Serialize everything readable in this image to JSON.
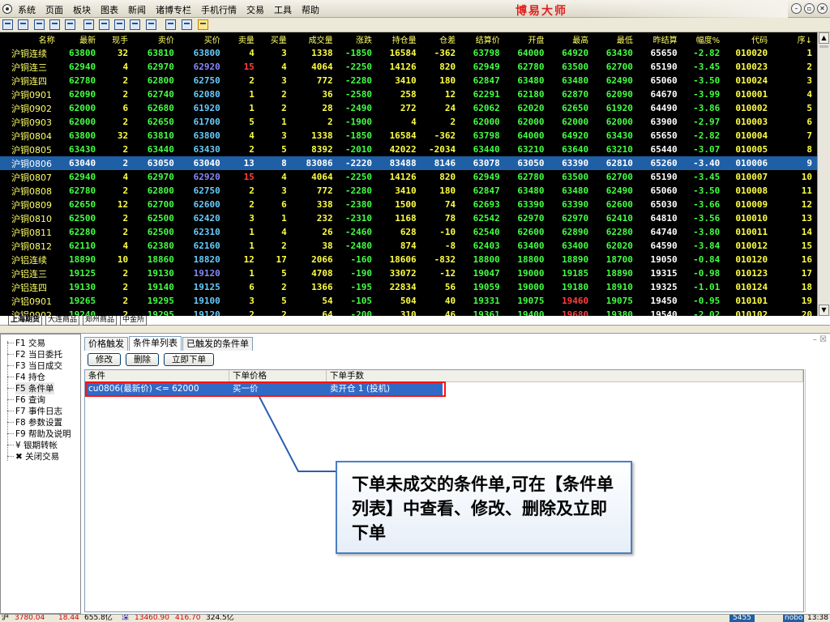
{
  "app": {
    "title": "博易大师"
  },
  "menu": [
    "系统",
    "页面",
    "板块",
    "图表",
    "新闻",
    "诸博专栏",
    "手机行情",
    "交易",
    "工具",
    "帮助"
  ],
  "toolbar_icons": [
    "window-icon",
    "line-chart-icon",
    "grid-icon",
    "table-icon",
    "report-icon",
    "refresh-icon",
    "pin-icon",
    "pin2-icon",
    "timer-icon",
    "export-icon",
    "alert-icon",
    "group-icon",
    "flash-icon"
  ],
  "quotes": {
    "columns": [
      "名称",
      "最新",
      "现手",
      "卖价",
      "买价",
      "卖量",
      "买量",
      "成交量",
      "涨跌",
      "持仓量",
      "仓差",
      "结算价",
      "开盘",
      "最高",
      "最低",
      "昨结算",
      "幅度%",
      "代码",
      "序↓"
    ],
    "rows": [
      {
        "name": "沪铜连续",
        "last": "63800",
        "vol": "32",
        "ask": "63810",
        "bid": "63800",
        "askv": "4",
        "bidv": "3",
        "volume": "1338",
        "chg": "-1850",
        "oi": "16584",
        "oid": "-362",
        "settle": "63798",
        "open": "64000",
        "high": "64920",
        "low": "63430",
        "prev": "65650",
        "pct": "-2.82",
        "code": "010020",
        "seq": "1"
      },
      {
        "name": "沪铜连三",
        "last": "62940",
        "vol": "4",
        "ask": "62970",
        "bid": "62920",
        "askv": "15",
        "bidv": "4",
        "volume": "4064",
        "chg": "-2250",
        "oi": "14126",
        "oid": "820",
        "settle": "62949",
        "open": "62780",
        "high": "63500",
        "low": "62700",
        "prev": "65190",
        "pct": "-3.45",
        "code": "010023",
        "seq": "2"
      },
      {
        "name": "沪铜连四",
        "last": "62780",
        "vol": "2",
        "ask": "62800",
        "bid": "62750",
        "askv": "2",
        "bidv": "3",
        "volume": "772",
        "chg": "-2280",
        "oi": "3410",
        "oid": "180",
        "settle": "62847",
        "open": "63480",
        "high": "63480",
        "low": "62490",
        "prev": "65060",
        "pct": "-3.50",
        "code": "010024",
        "seq": "3"
      },
      {
        "name": "沪铜0901",
        "last": "62090",
        "vol": "2",
        "ask": "62740",
        "bid": "62080",
        "askv": "1",
        "bidv": "2",
        "volume": "36",
        "chg": "-2580",
        "oi": "258",
        "oid": "12",
        "settle": "62291",
        "open": "62180",
        "high": "62870",
        "low": "62090",
        "prev": "64670",
        "pct": "-3.99",
        "code": "010001",
        "seq": "4"
      },
      {
        "name": "沪铜0902",
        "last": "62000",
        "vol": "6",
        "ask": "62680",
        "bid": "61920",
        "askv": "1",
        "bidv": "2",
        "volume": "28",
        "chg": "-2490",
        "oi": "272",
        "oid": "24",
        "settle": "62062",
        "open": "62020",
        "high": "62650",
        "low": "61920",
        "prev": "64490",
        "pct": "-3.86",
        "code": "010002",
        "seq": "5"
      },
      {
        "name": "沪铜0903",
        "last": "62000",
        "vol": "2",
        "ask": "62650",
        "bid": "61700",
        "askv": "5",
        "bidv": "1",
        "volume": "2",
        "chg": "-1900",
        "oi": "4",
        "oid": "2",
        "settle": "62000",
        "open": "62000",
        "high": "62000",
        "low": "62000",
        "prev": "63900",
        "pct": "-2.97",
        "code": "010003",
        "seq": "6"
      },
      {
        "name": "沪铜0804",
        "last": "63800",
        "vol": "32",
        "ask": "63810",
        "bid": "63800",
        "askv": "4",
        "bidv": "3",
        "volume": "1338",
        "chg": "-1850",
        "oi": "16584",
        "oid": "-362",
        "settle": "63798",
        "open": "64000",
        "high": "64920",
        "low": "63430",
        "prev": "65650",
        "pct": "-2.82",
        "code": "010004",
        "seq": "7"
      },
      {
        "name": "沪铜0805",
        "last": "63430",
        "vol": "2",
        "ask": "63440",
        "bid": "63430",
        "askv": "2",
        "bidv": "5",
        "volume": "8392",
        "chg": "-2010",
        "oi": "42022",
        "oid": "-2034",
        "settle": "63440",
        "open": "63210",
        "high": "63640",
        "low": "63210",
        "prev": "65440",
        "pct": "-3.07",
        "code": "010005",
        "seq": "8"
      },
      {
        "name": "沪铜0806",
        "last": "63040",
        "vol": "2",
        "ask": "63050",
        "bid": "63040",
        "askv": "13",
        "bidv": "8",
        "volume": "83086",
        "chg": "-2220",
        "oi": "83488",
        "oid": "8146",
        "settle": "63078",
        "open": "63050",
        "high": "63390",
        "low": "62810",
        "prev": "65260",
        "pct": "-3.40",
        "code": "010006",
        "seq": "9"
      },
      {
        "name": "沪铜0807",
        "last": "62940",
        "vol": "4",
        "ask": "62970",
        "bid": "62920",
        "askv": "15",
        "bidv": "4",
        "volume": "4064",
        "chg": "-2250",
        "oi": "14126",
        "oid": "820",
        "settle": "62949",
        "open": "62780",
        "high": "63500",
        "low": "62700",
        "prev": "65190",
        "pct": "-3.45",
        "code": "010007",
        "seq": "10"
      },
      {
        "name": "沪铜0808",
        "last": "62780",
        "vol": "2",
        "ask": "62800",
        "bid": "62750",
        "askv": "2",
        "bidv": "3",
        "volume": "772",
        "chg": "-2280",
        "oi": "3410",
        "oid": "180",
        "settle": "62847",
        "open": "63480",
        "high": "63480",
        "low": "62490",
        "prev": "65060",
        "pct": "-3.50",
        "code": "010008",
        "seq": "11"
      },
      {
        "name": "沪铜0809",
        "last": "62650",
        "vol": "12",
        "ask": "62700",
        "bid": "62600",
        "askv": "2",
        "bidv": "6",
        "volume": "338",
        "chg": "-2380",
        "oi": "1500",
        "oid": "74",
        "settle": "62693",
        "open": "63390",
        "high": "63390",
        "low": "62600",
        "prev": "65030",
        "pct": "-3.66",
        "code": "010009",
        "seq": "12"
      },
      {
        "name": "沪铜0810",
        "last": "62500",
        "vol": "2",
        "ask": "62500",
        "bid": "62420",
        "askv": "3",
        "bidv": "1",
        "volume": "232",
        "chg": "-2310",
        "oi": "1168",
        "oid": "78",
        "settle": "62542",
        "open": "62970",
        "high": "62970",
        "low": "62410",
        "prev": "64810",
        "pct": "-3.56",
        "code": "010010",
        "seq": "13"
      },
      {
        "name": "沪铜0811",
        "last": "62280",
        "vol": "2",
        "ask": "62500",
        "bid": "62310",
        "askv": "1",
        "bidv": "4",
        "volume": "26",
        "chg": "-2460",
        "oi": "628",
        "oid": "-10",
        "settle": "62540",
        "open": "62600",
        "high": "62890",
        "low": "62280",
        "prev": "64740",
        "pct": "-3.80",
        "code": "010011",
        "seq": "14"
      },
      {
        "name": "沪铜0812",
        "last": "62110",
        "vol": "4",
        "ask": "62380",
        "bid": "62160",
        "askv": "1",
        "bidv": "2",
        "volume": "38",
        "chg": "-2480",
        "oi": "874",
        "oid": "-8",
        "settle": "62403",
        "open": "63400",
        "high": "63400",
        "low": "62020",
        "prev": "64590",
        "pct": "-3.84",
        "code": "010012",
        "seq": "15"
      },
      {
        "name": "沪铝连续",
        "last": "18890",
        "vol": "10",
        "ask": "18860",
        "bid": "18820",
        "askv": "12",
        "bidv": "17",
        "volume": "2066",
        "chg": "-160",
        "oi": "18606",
        "oid": "-832",
        "settle": "18800",
        "open": "18800",
        "high": "18890",
        "low": "18700",
        "prev": "19050",
        "pct": "-0.84",
        "code": "010120",
        "seq": "16"
      },
      {
        "name": "沪铝连三",
        "last": "19125",
        "vol": "2",
        "ask": "19130",
        "bid": "19120",
        "askv": "1",
        "bidv": "5",
        "volume": "4708",
        "chg": "-190",
        "oi": "33072",
        "oid": "-12",
        "settle": "19047",
        "open": "19000",
        "high": "19185",
        "low": "18890",
        "prev": "19315",
        "pct": "-0.98",
        "code": "010123",
        "seq": "17"
      },
      {
        "name": "沪铝连四",
        "last": "19130",
        "vol": "2",
        "ask": "19140",
        "bid": "19125",
        "askv": "6",
        "bidv": "2",
        "volume": "1366",
        "chg": "-195",
        "oi": "22834",
        "oid": "56",
        "settle": "19059",
        "open": "19000",
        "high": "19180",
        "low": "18910",
        "prev": "19325",
        "pct": "-1.01",
        "code": "010124",
        "seq": "18"
      },
      {
        "name": "沪铝0901",
        "last": "19265",
        "vol": "2",
        "ask": "19295",
        "bid": "19100",
        "askv": "3",
        "bidv": "5",
        "volume": "54",
        "chg": "-105",
        "oi": "504",
        "oid": "40",
        "settle": "19331",
        "open": "19075",
        "high": "19460",
        "low": "19075",
        "prev": "19450",
        "pct": "-0.95",
        "code": "010101",
        "seq": "19"
      },
      {
        "name": "沪铝0902",
        "last": "19240",
        "vol": "2",
        "ask": "19295",
        "bid": "19120",
        "askv": "2",
        "bidv": "2",
        "volume": "64",
        "chg": "-200",
        "oi": "310",
        "oid": "46",
        "settle": "19361",
        "open": "19400",
        "high": "19680",
        "low": "19380",
        "prev": "19540",
        "pct": "-2.02",
        "code": "010102",
        "seq": "20"
      }
    ]
  },
  "exchange_tabs": [
    "上海期货",
    "大连商品",
    "郑州商品",
    "中金所"
  ],
  "left_nav": [
    "F1 交易",
    "F2 当日委托",
    "F3 当日成交",
    "F4 持仓",
    "F5 条件单",
    "F6 查询",
    "F7 事件日志",
    "F8 参数设置",
    "F9 帮助及说明",
    "¥ 银期转帐",
    "✖ 关闭交易"
  ],
  "panel_tabs": [
    "价格触发",
    "条件单列表",
    "已触发的条件单"
  ],
  "panel_buttons": [
    "修改",
    "删除",
    "立即下单"
  ],
  "grid": {
    "headers": [
      "条件",
      "下单价格",
      "下单手数"
    ],
    "row": [
      "cu0806(最新价) <= 62000",
      "买一价",
      "卖开仓 1 (投机)"
    ]
  },
  "callout": "下单未成交的条件单,可在【条件单列表】中查看、修改、删除及立即下单",
  "statusbar": [
    "沪",
    "3780.04",
    "18.44",
    "655.8亿",
    "深",
    "13460.90",
    "416.70",
    "324.5亿",
    "5455",
    "nobo",
    "13:38"
  ]
}
